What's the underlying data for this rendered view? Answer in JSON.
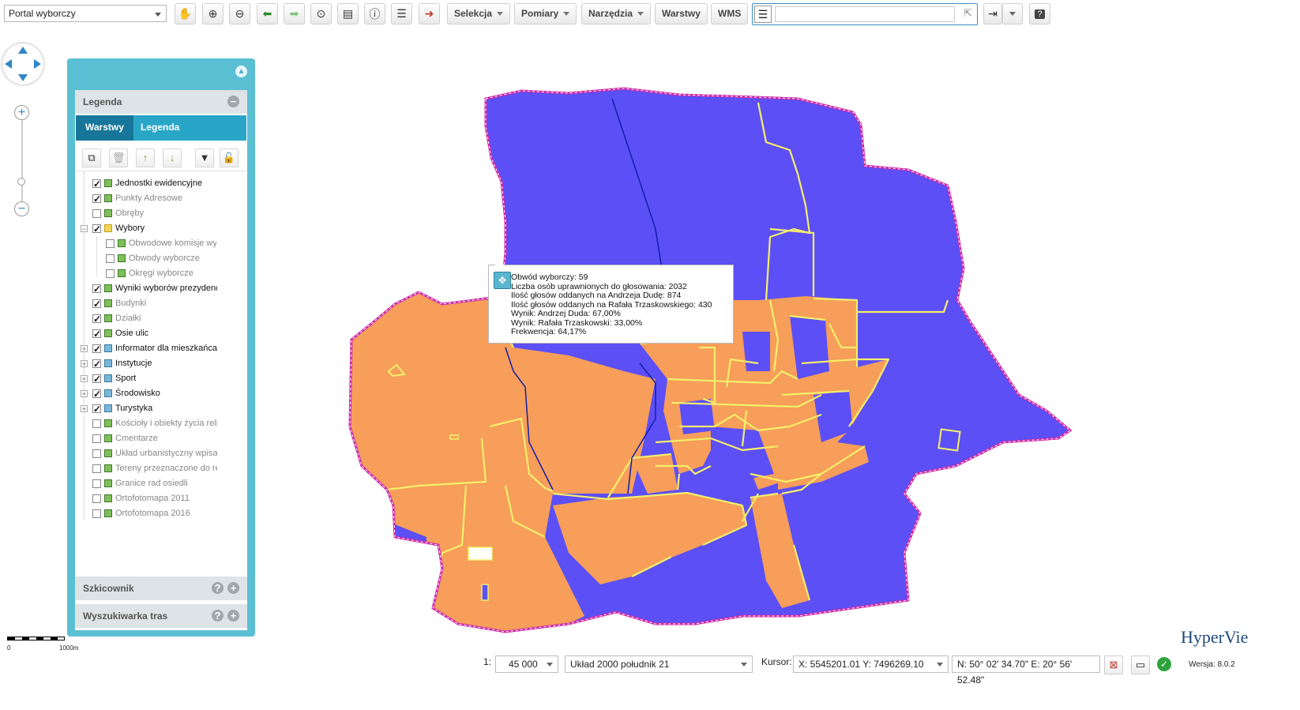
{
  "toolbar": {
    "portal_select": "Portal wyborczy",
    "menus": [
      "Selekcja",
      "Pomiary",
      "Narzędzia"
    ],
    "buttons": [
      "Warstwy",
      "WMS"
    ],
    "search_value": "",
    "search_placeholder": ""
  },
  "panel": {
    "legend_title": "Legenda",
    "tabs": [
      "Warstwy",
      "Legenda"
    ],
    "layers": [
      {
        "label": "Jednostki ewidencyjne",
        "checked": true
      },
      {
        "label": "Punkty Adresowe",
        "checked": true
      },
      {
        "label": "Obręby",
        "checked": false
      },
      {
        "label": "Wybory",
        "checked": true
      },
      {
        "label": "Obwodowe komisje wyb",
        "checked": false
      },
      {
        "label": "Obwody wyborcze",
        "checked": false
      },
      {
        "label": "Okręgi wyborcze",
        "checked": false
      },
      {
        "label": "Wyniki wyborów prezydenc",
        "checked": true
      },
      {
        "label": "Budynki",
        "checked": true
      },
      {
        "label": "Działki",
        "checked": true
      },
      {
        "label": "Osie ulic",
        "checked": true
      },
      {
        "label": "Informator dla mieszkańca",
        "checked": true
      },
      {
        "label": "Instytucje",
        "checked": true
      },
      {
        "label": "Sport",
        "checked": true
      },
      {
        "label": "Środowisko",
        "checked": true
      },
      {
        "label": "Turystyka",
        "checked": true
      },
      {
        "label": "Kościoły i obiekty życia reli",
        "checked": false
      },
      {
        "label": "Cmentarze",
        "checked": false
      },
      {
        "label": "Układ urbanistyczny wpisa",
        "checked": false
      },
      {
        "label": "Tereny przeznaczone do re",
        "checked": false
      },
      {
        "label": "Granice rad osiedli",
        "checked": false
      },
      {
        "label": "Ortofotomapa 2011",
        "checked": false
      },
      {
        "label": "Ortofotomapa 2016",
        "checked": false
      }
    ],
    "sketch_title": "Szkicownik",
    "routes_title": "Wyszukiwarka tras"
  },
  "popup": {
    "lines": [
      "Obwód wyborczy: 59",
      "Liczba osób uprawnionych do głosowania: 2032",
      "Ilość głosów oddanych na Andrzeja Dudę: 874",
      "Ilość głosów oddanych na Rafała Trzaskowskiego: 430",
      "Wynik: Andrzej Duda: 67,00%",
      "Wynik: Rafała Trzaskowski: 33,00%",
      "Frekwencja: 64,17%"
    ]
  },
  "map_colors": {
    "duda": "#f69e5a",
    "trzaskowski": "#5c4ff6",
    "border": "#f4ef6a",
    "outline": "#cc2aa8"
  },
  "scalebar": {
    "start": "0",
    "end": "1000m"
  },
  "status": {
    "scale_prefix": "1:",
    "scale_value": "45 000",
    "crs": "Układ 2000 południk 21",
    "cursor_label": "Kursor:",
    "cursor_xy": "X: 5545201.01  Y: 7496269.10",
    "cursor_geo": "N: 50° 02' 34.70\"  E: 20° 56' 52.48\"",
    "version": "Wersja: 8.0.2"
  },
  "logo": "HyperVie"
}
